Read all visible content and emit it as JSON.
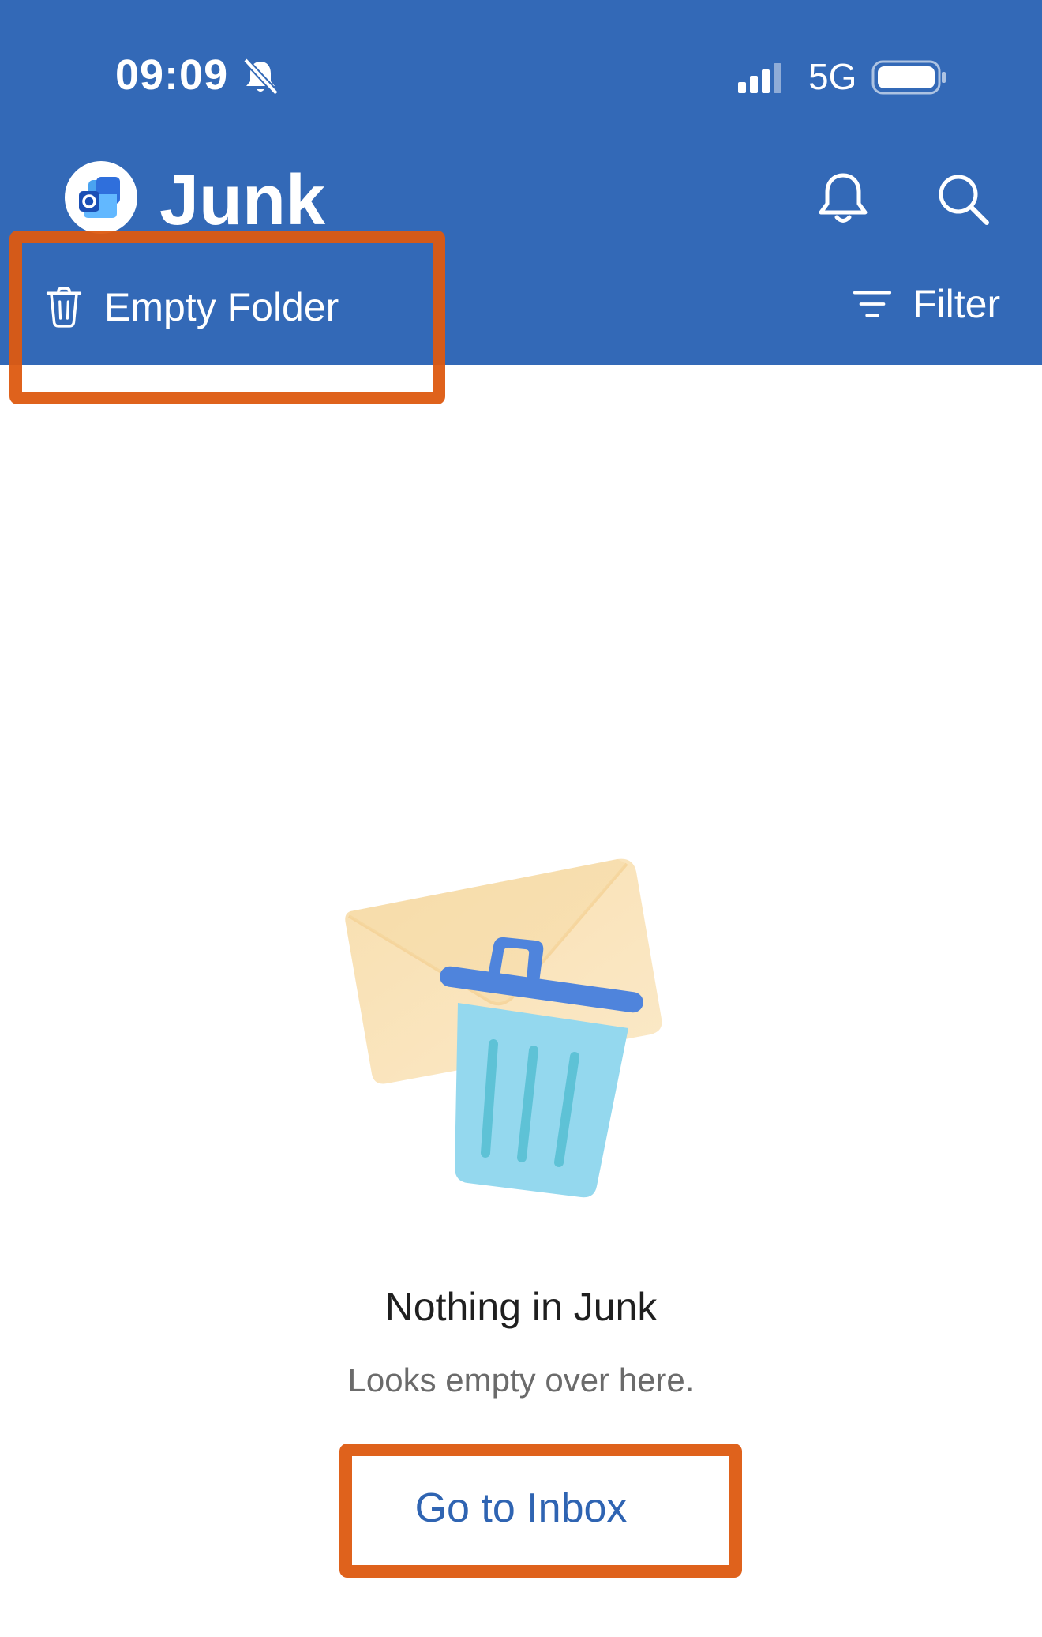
{
  "status_bar": {
    "time": "09:09",
    "network": "5G",
    "icons": [
      "bell-slash-icon",
      "signal-icon",
      "battery-icon"
    ]
  },
  "header": {
    "title": "Junk",
    "logo_icon": "outlook-app-icon",
    "actions": [
      "bell-icon",
      "search-icon"
    ],
    "background_color": "#3369b7"
  },
  "toolbar": {
    "empty_folder_label": "Empty Folder",
    "empty_folder_icon": "trash-icon",
    "filter_label": "Filter",
    "filter_icon": "filter-icon"
  },
  "empty_state": {
    "illustration": "envelope-and-trash-icon",
    "title": "Nothing in Junk",
    "subtitle": "Looks empty over here.",
    "action_label": "Go to Inbox",
    "action_color": "#2f64b2"
  },
  "annotations": {
    "color": "#dd5a10"
  }
}
